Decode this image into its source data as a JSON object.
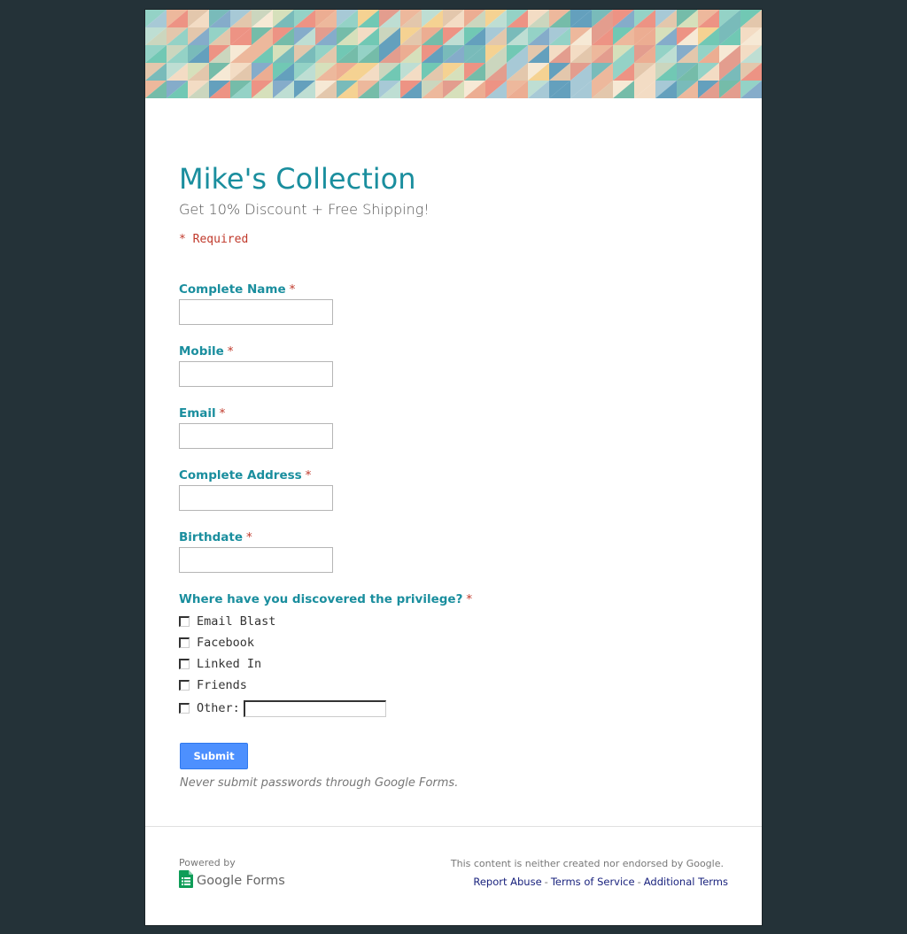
{
  "form": {
    "title": "Mike's Collection",
    "subtitle": "Get 10% Discount + Free Shipping!",
    "required_note": "* Required",
    "required_marker": "*",
    "fields": [
      {
        "label": "Complete Name",
        "value": ""
      },
      {
        "label": "Mobile",
        "value": ""
      },
      {
        "label": "Email",
        "value": ""
      },
      {
        "label": "Complete Address",
        "value": ""
      },
      {
        "label": "Birthdate",
        "value": ""
      }
    ],
    "question": {
      "label": "Where have you discovered the privilege?",
      "options": [
        "Email Blast",
        "Facebook",
        "Linked In",
        "Friends"
      ],
      "other_label": "Other:",
      "other_value": ""
    },
    "submit_label": "Submit",
    "password_warning": "Never submit passwords through Google Forms."
  },
  "footer": {
    "powered_by": "Powered by",
    "logo_text": "Google Forms",
    "disclaimer": "This content is neither created nor endorsed by Google.",
    "links": [
      "Report Abuse",
      "Terms of Service",
      "Additional Terms"
    ],
    "separator": "-"
  },
  "colors": {
    "page_background": "#243238",
    "accent": "#1a8e9e",
    "required": "#c0392b",
    "button": "#4d90fe",
    "link": "#1a237e",
    "logo_green": "#0f9d58"
  },
  "icons": {
    "banner": "geometric-pattern-banner",
    "logo": "google-forms-icon"
  }
}
